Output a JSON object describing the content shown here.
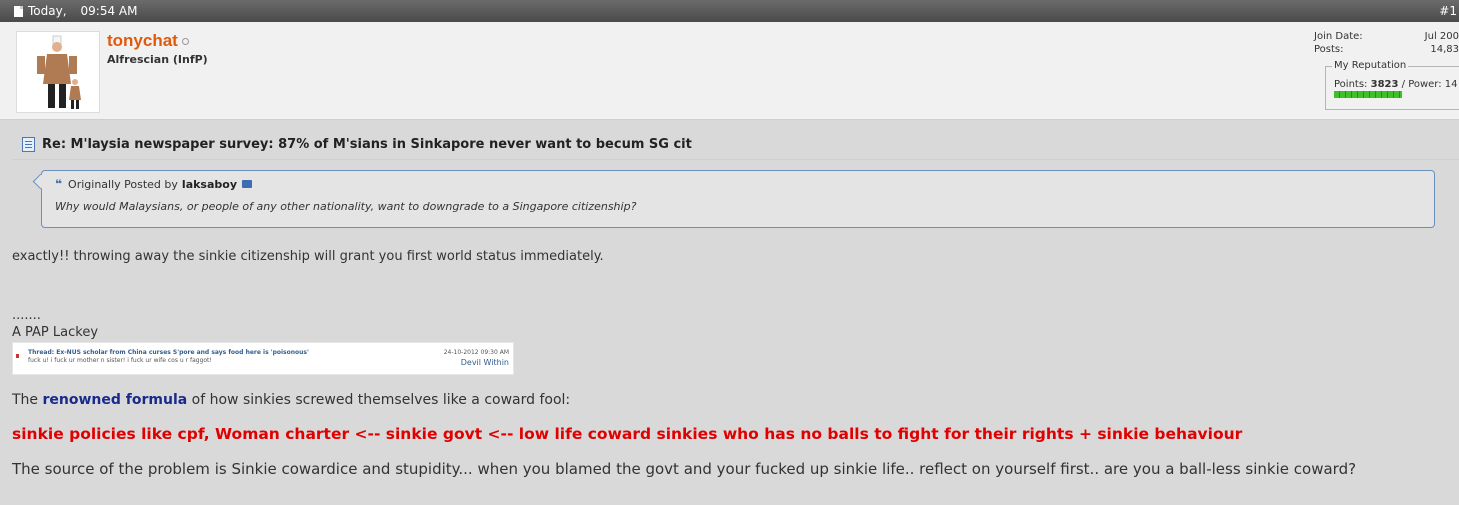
{
  "post_header": {
    "date": "Today,",
    "time": "09:54 AM",
    "post_number": "#1"
  },
  "user": {
    "username": "tonychat",
    "title": "Alfrescian (InfP)",
    "join_date_label": "Join Date:",
    "join_date_value": "Jul 200",
    "posts_label": "Posts:",
    "posts_value": "14,83",
    "reputation": {
      "legend": "My Reputation",
      "points_label": "Points:",
      "points_value": "3823",
      "power_label": "/ Power: 14"
    }
  },
  "post": {
    "title": "Re: M'laysia newspaper survey: 87% of M'sians in Sinkapore never want to becum SG cit",
    "quote": {
      "prefix": "Originally Posted by",
      "author": "laksaboy",
      "text": "Why would Malaysians, or people of any other nationality, want to downgrade to a Singapore citizenship?"
    },
    "reply": "exactly!! throwing away the sinkie citizenship will grant you first world status immediately."
  },
  "signature": {
    "dots": ".......",
    "lackey": "A PAP Lackey",
    "image": {
      "thread_line": "Thread: Ex-NUS scholar from China curses S'pore and says food here is 'poisonous'",
      "quote_line": "fuck u! i fuck ur mother n sister! i fuck ur wife cos u r faggot!",
      "date": "24-10-2012 09:30 AM",
      "user": "Devil Within"
    },
    "formula_prefix": "The",
    "formula_link": "renowned formula",
    "formula_suffix": "of how sinkies screwed themselves like a coward fool:",
    "red_line": "sinkie policies like cpf, Woman charter <-- sinkie govt <-- low life coward sinkies who has no balls to fight for their rights + sinkie behaviour",
    "source_text": "The source of the problem is Sinkie cowardice and stupidity... when you blamed the govt and your fucked up sinkie life.. reflect on yourself first.. are you a ball-less sinkie coward?"
  },
  "colors": {
    "username": "#e05a0c",
    "red_text": "#e00000",
    "link": "#1a2a8c",
    "quote_border": "#6b8fbf"
  }
}
